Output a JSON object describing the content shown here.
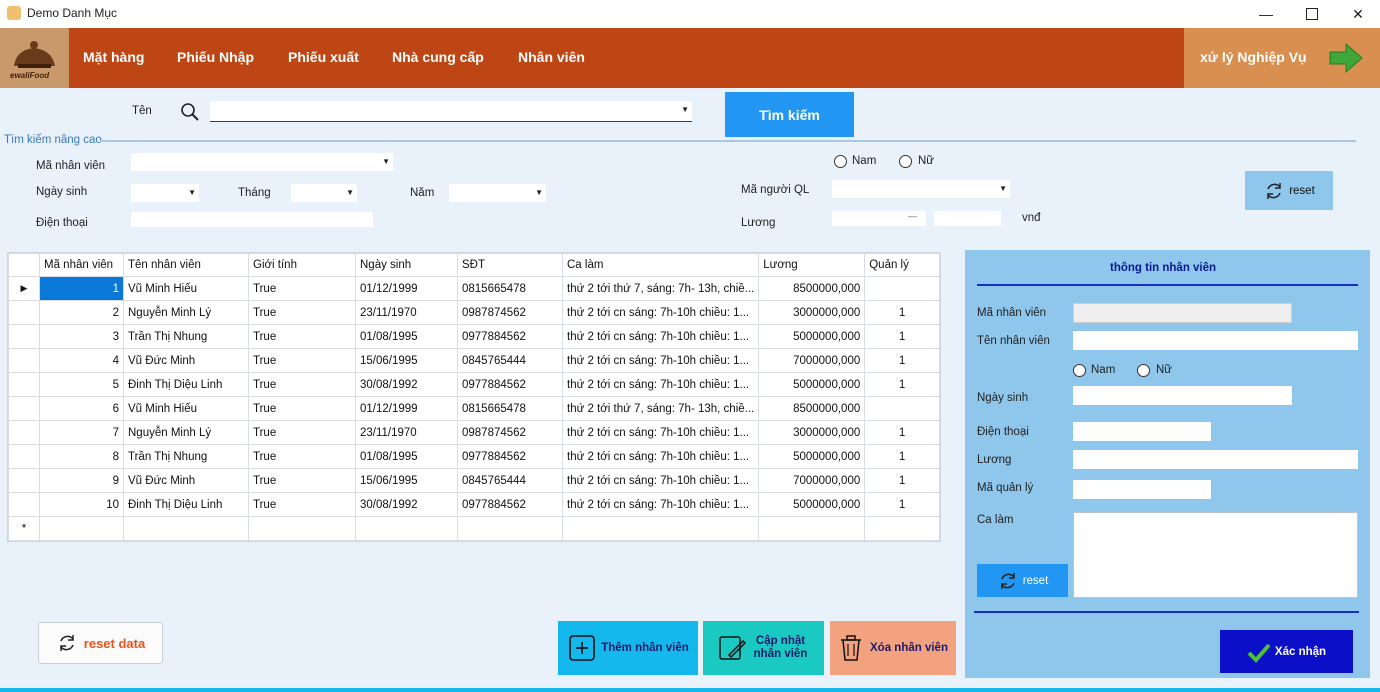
{
  "window": {
    "title": "Demo Danh Mục"
  },
  "menu": {
    "logo_text": "ewaliFood",
    "items": [
      "Mặt hàng",
      "Phiếu Nhập",
      "Phiếu xuất",
      "Nhà cung cấp",
      "Nhân viên"
    ],
    "business": "xử lý Nghiệp Vụ"
  },
  "search": {
    "name_label": "Tên",
    "button": "Tìm kiếm",
    "advanced_label": "Tìm kiếm nâng cao",
    "employee_id_label": "Mã nhân viên",
    "dob_label": "Ngày sinh",
    "month_label": "Tháng",
    "year_label": "Năm",
    "phone_label": "Điện thoại",
    "male": "Nam",
    "female": "Nữ",
    "manager_label": "Mã người QL",
    "salary_label": "Lương",
    "salary_sep": "—",
    "currency": "vnđ",
    "reset": "reset"
  },
  "grid": {
    "columns": [
      "Mã nhân viên",
      "Tên nhân viên",
      "Giới tính",
      "Ngày sinh",
      "SĐT",
      "Ca làm",
      "Lương",
      "Quản lý"
    ],
    "rows": [
      [
        "1",
        "Vũ Minh Hiếu",
        "True",
        "01/12/1999",
        "0815665478",
        "thứ 2 tới thứ 7, sáng: 7h- 13h, chiề...",
        "8500000,000",
        ""
      ],
      [
        "2",
        "Nguyễn Minh Lý",
        "True",
        "23/11/1970",
        "0987874562",
        "thứ 2 tới cn sáng: 7h-10h chiều: 1...",
        "3000000,000",
        "1"
      ],
      [
        "3",
        "Trần Thị Nhung",
        "True",
        "01/08/1995",
        "0977884562",
        "thứ 2 tới cn sáng: 7h-10h chiều: 1...",
        "5000000,000",
        "1"
      ],
      [
        "4",
        "Vũ Đức Minh",
        "True",
        "15/06/1995",
        "0845765444",
        "thứ 2 tới cn sáng: 7h-10h chiều: 1...",
        "7000000,000",
        "1"
      ],
      [
        "5",
        "Đinh Thị Diệu Linh",
        "True",
        "30/08/1992",
        "0977884562",
        "thứ 2 tới cn sáng: 7h-10h chiều: 1...",
        "5000000,000",
        "1"
      ],
      [
        "6",
        "Vũ Minh Hiếu",
        "True",
        "01/12/1999",
        "0815665478",
        "thứ 2 tới thứ 7, sáng: 7h- 13h, chiề...",
        "8500000,000",
        ""
      ],
      [
        "7",
        "Nguyễn Minh Lý",
        "True",
        "23/11/1970",
        "0987874562",
        "thứ 2 tới cn sáng: 7h-10h chiều: 1...",
        "3000000,000",
        "1"
      ],
      [
        "8",
        "Trần Thị Nhung",
        "True",
        "01/08/1995",
        "0977884562",
        "thứ 2 tới cn sáng: 7h-10h chiều: 1...",
        "5000000,000",
        "1"
      ],
      [
        "9",
        "Vũ Đức Minh",
        "True",
        "15/06/1995",
        "0845765444",
        "thứ 2 tới cn sáng: 7h-10h chiều: 1...",
        "7000000,000",
        "1"
      ],
      [
        "10",
        "Đinh Thị Diệu Linh",
        "True",
        "30/08/1992",
        "0977884562",
        "thứ 2 tới cn sáng: 7h-10h chiều: 1...",
        "5000000,000",
        "1"
      ]
    ],
    "new_row_marker": "*",
    "current_row_marker": "▶"
  },
  "panel": {
    "title": "thông tin nhân viên",
    "id_label": "Mã nhân viên",
    "name_label": "Tên nhân viên",
    "male": "Nam",
    "female": "Nữ",
    "dob_label": "Ngày sinh",
    "phone_label": "Điện thoại",
    "salary_label": "Lương",
    "manager_label": "Mã quản lý",
    "shift_label": "Ca làm",
    "reset": "reset",
    "confirm": "Xác nhận"
  },
  "actions": {
    "reset_data": "reset data",
    "add": "Thêm nhân viên",
    "update": "Cập nhật nhân viên",
    "delete": "Xóa nhân viên"
  },
  "colors": {
    "menubar": "#bd4614",
    "search_button": "#2196f3",
    "panel": "#8ec6ec",
    "confirm": "#0b10c8",
    "add": "#15b8ec",
    "update": "#19c9c2",
    "delete": "#f2a27f"
  }
}
